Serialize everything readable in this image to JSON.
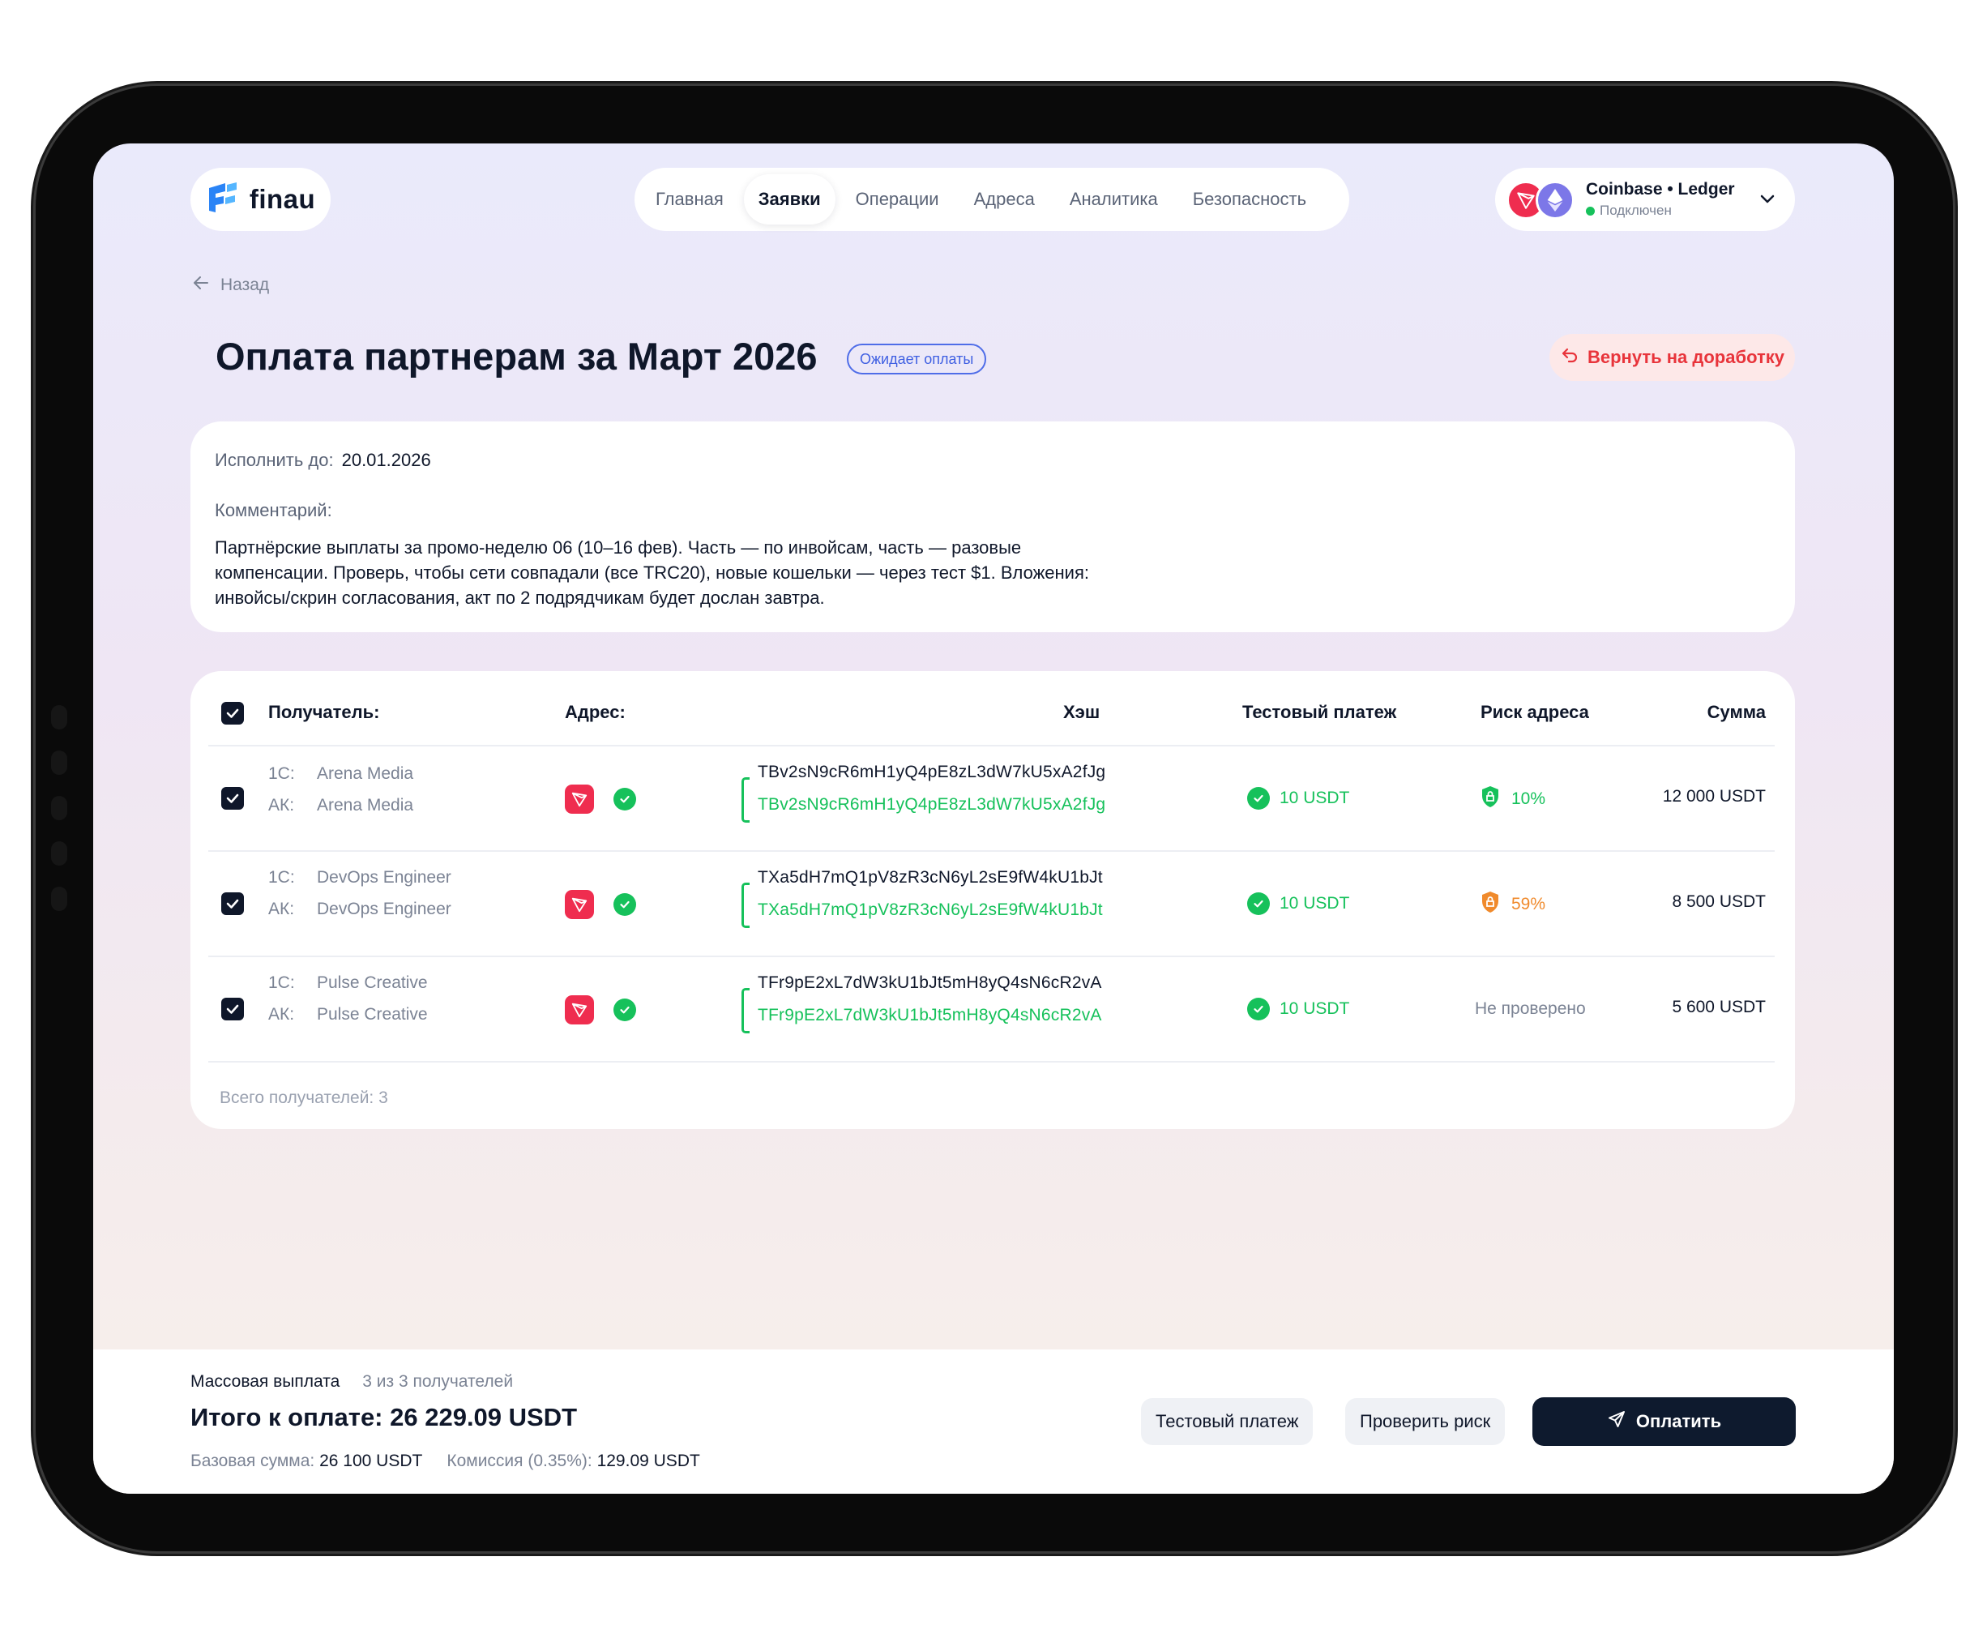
{
  "app": {
    "logo_text": "finau"
  },
  "nav": {
    "items": [
      "Главная",
      "Заявки",
      "Операции",
      "Адреса",
      "Аналитика",
      "Безопасность"
    ],
    "active_index": 1
  },
  "wallet": {
    "name": "Coinbase • Ledger",
    "status": "Подключен"
  },
  "page": {
    "back_label": "Назад",
    "title": "Оплата партнерам за Март 2026",
    "status_badge": "Ожидает оплаты",
    "return_button": "Вернуть на доработку"
  },
  "info": {
    "due_label": "Исполнить до:",
    "due_value": "20.01.2026",
    "comment_label": "Комментарий:",
    "comment_text": "Партнёрские выплаты за промо-неделю 06 (10–16 фев). Часть — по инвойсам, часть — разовые компенсации. Проверь, чтобы сети совпадали (все TRC20), новые кошельки — через тест $1. Вложения: инвойсы/скрин согласования, акт по 2 подрядчикам будет дослан завтра."
  },
  "table": {
    "headers": {
      "recipient": "Получатель:",
      "address": "Адрес:",
      "hash": "Хэш",
      "test": "Тестовый платеж",
      "risk": "Риск адреса",
      "amount": "Сумма"
    },
    "label_1c": "1С:",
    "label_ak": "АК:",
    "rows": [
      {
        "name_1c": "Arena Media",
        "name_ak": "Arena Media",
        "address": "TBv2sN9cR6mH1yQ4pE8zL3dW7kU5xA2fJg",
        "address_confirm": "TBv2sN9cR6mH1yQ4pE8zL3dW7kU5xA2fJg",
        "test_payment": "10 USDT",
        "risk": "10%",
        "risk_level": "low",
        "amount": "12 000 USDT"
      },
      {
        "name_1c": "DevOps Engineer",
        "name_ak": "DevOps Engineer",
        "address": "TXa5dH7mQ1pV8zR3cN6yL2sE9fW4kU1bJt",
        "address_confirm": "TXa5dH7mQ1pV8zR3cN6yL2sE9fW4kU1bJt",
        "test_payment": "10 USDT",
        "risk": "59%",
        "risk_level": "medium",
        "amount": "8 500 USDT"
      },
      {
        "name_1c": "Pulse Creative",
        "name_ak": "Pulse Creative",
        "address": "TFr9pE2xL7dW3kU1bJt5mH8yQ4sN6cR2vA",
        "address_confirm": "TFr9pE2xL7dW3kU1bJt5mH8yQ4sN6cR2vA",
        "test_payment": "10 USDT",
        "risk": "Не проверено",
        "risk_level": "none",
        "amount": "5 600 USDT"
      }
    ],
    "total_recipients": "Всего получателей: 3"
  },
  "footer": {
    "batch_label": "Массовая выплата",
    "batch_count": "3 из 3 получателей",
    "total_label": "Итого к оплате: 26 229.09 USDT",
    "base_label": "Базовая сумма:",
    "base_value": "26 100 USDT",
    "fee_label": "Комиссия (0.35%):",
    "fee_value": "129.09 USDT",
    "test_button": "Тестовый платеж",
    "risk_button": "Проверить риск",
    "pay_button": "Оплатить"
  },
  "colors": {
    "accent": "#3f5fe2",
    "success": "#16c15b",
    "warning": "#f08a2c",
    "danger": "#e8343b",
    "tron": "#ef2d4f",
    "primary_button": "#0e1a2e"
  },
  "icons": [
    "finau-logo-icon",
    "tron-icon",
    "ethereum-icon",
    "chevron-down-icon",
    "arrow-left-icon",
    "undo-icon",
    "check-circle-icon",
    "shield-icon",
    "checkbox-checked-icon",
    "send-icon"
  ]
}
